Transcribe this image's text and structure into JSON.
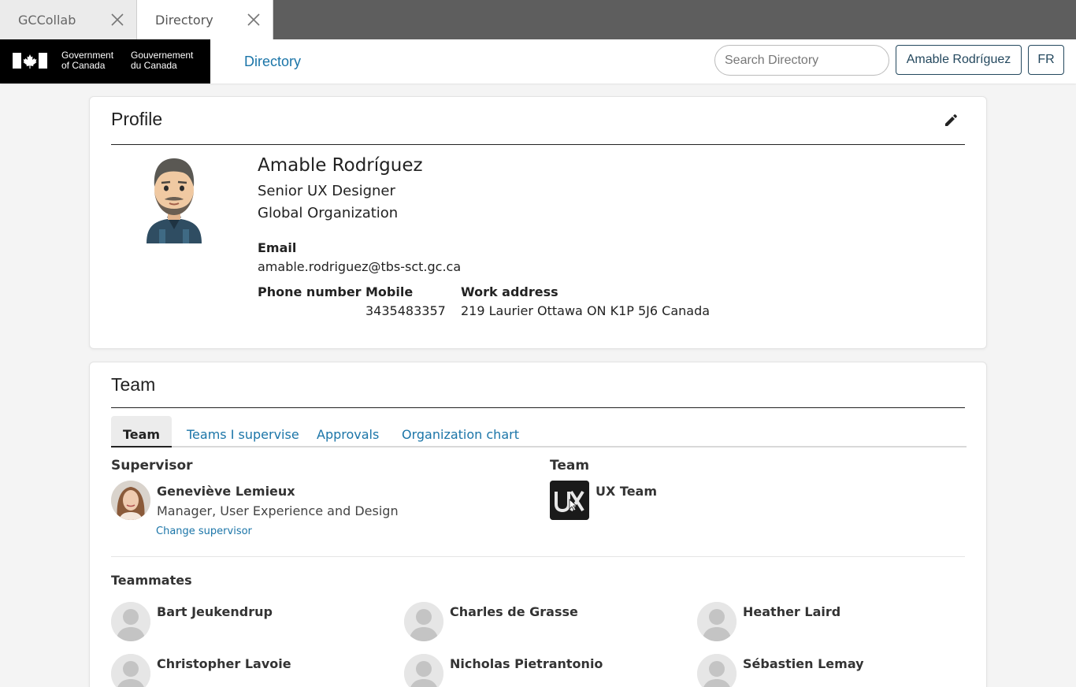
{
  "browser": {
    "tabs": [
      {
        "label": "GCCollab"
      },
      {
        "label": "Directory"
      }
    ]
  },
  "header": {
    "goc_en_line1": "Government",
    "goc_en_line2": "of Canada",
    "goc_fr_line1": "Gouvernement",
    "goc_fr_line2": "du Canada",
    "nav_title": "Directory",
    "search_placeholder": "Search Directory",
    "user_button": "Amable Rodríguez",
    "lang_button": "FR"
  },
  "profile": {
    "heading": "Profile",
    "name": "Amable Rodríguez",
    "job_title": "Senior UX Designer",
    "organization": "Global Organization",
    "email_label": "Email",
    "email": "amable.rodriguez@tbs-sct.gc.ca",
    "phone_label": "Phone number",
    "phone": "",
    "mobile_label": "Mobile",
    "mobile": "3435483357",
    "address_label": "Work address",
    "address": "219 Laurier Ottawa ON K1P 5J6 Canada"
  },
  "team": {
    "heading": "Team",
    "tabs": [
      "Team",
      "Teams I supervise",
      "Approvals",
      "Organization chart"
    ],
    "supervisor_heading": "Supervisor",
    "supervisor": {
      "name": "Geneviève Lemieux",
      "title": "Manager, User Experience and Design",
      "change_link": "Change supervisor"
    },
    "team_heading": "Team",
    "team_name": "UX Team",
    "teammates_heading": "Teammates",
    "teammates": [
      "Bart Jeukendrup",
      "Charles de Grasse",
      "Heather Laird",
      "Christopher Lavoie",
      "Nicholas Pietrantonio",
      "Sébastien Lemay"
    ]
  },
  "colors": {
    "link": "#1b75a8",
    "button_border": "#24485e",
    "tabbar": "#5e5e5e"
  }
}
